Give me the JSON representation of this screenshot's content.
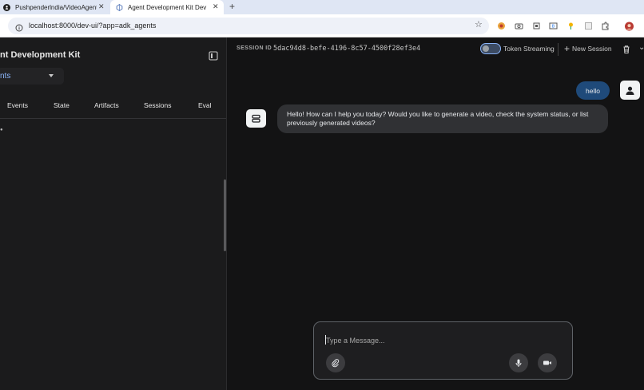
{
  "browser": {
    "tabs": [
      {
        "label": "Pushpenderlndia/VideoAgent",
        "icon": "github-icon",
        "close": "✕"
      },
      {
        "label": "Agent Development Kit Dev U",
        "icon": "adk-icon",
        "close": "✕"
      }
    ],
    "new_tab": "+",
    "url": "localhost:8000/dev-ui/?app=adk_agents"
  },
  "sidebar": {
    "title": "nt Development Kit",
    "agent_select": "nts",
    "tabs": [
      "Events",
      "State",
      "Artifacts",
      "Sessions",
      "Eval"
    ]
  },
  "topbar": {
    "session_label": "SESSION ID",
    "session_id": "5dac94d8-befe-4196-8c57-4500f28ef3e4",
    "token_streaming": "Token Streaming",
    "new_session": "New Session",
    "new_session_icon": "+"
  },
  "chat": {
    "messages": [
      {
        "role": "user",
        "text": "hello"
      },
      {
        "role": "bot",
        "text": "Hello! How can I help you today? Would you like to generate a video, check the system status, or list previously generated videos?"
      }
    ]
  },
  "composer": {
    "placeholder": "Type a Message..."
  },
  "colors": {
    "user_bubble": "#1f4a7a",
    "bot_bubble": "#303134",
    "accent": "#8ab4f8"
  }
}
